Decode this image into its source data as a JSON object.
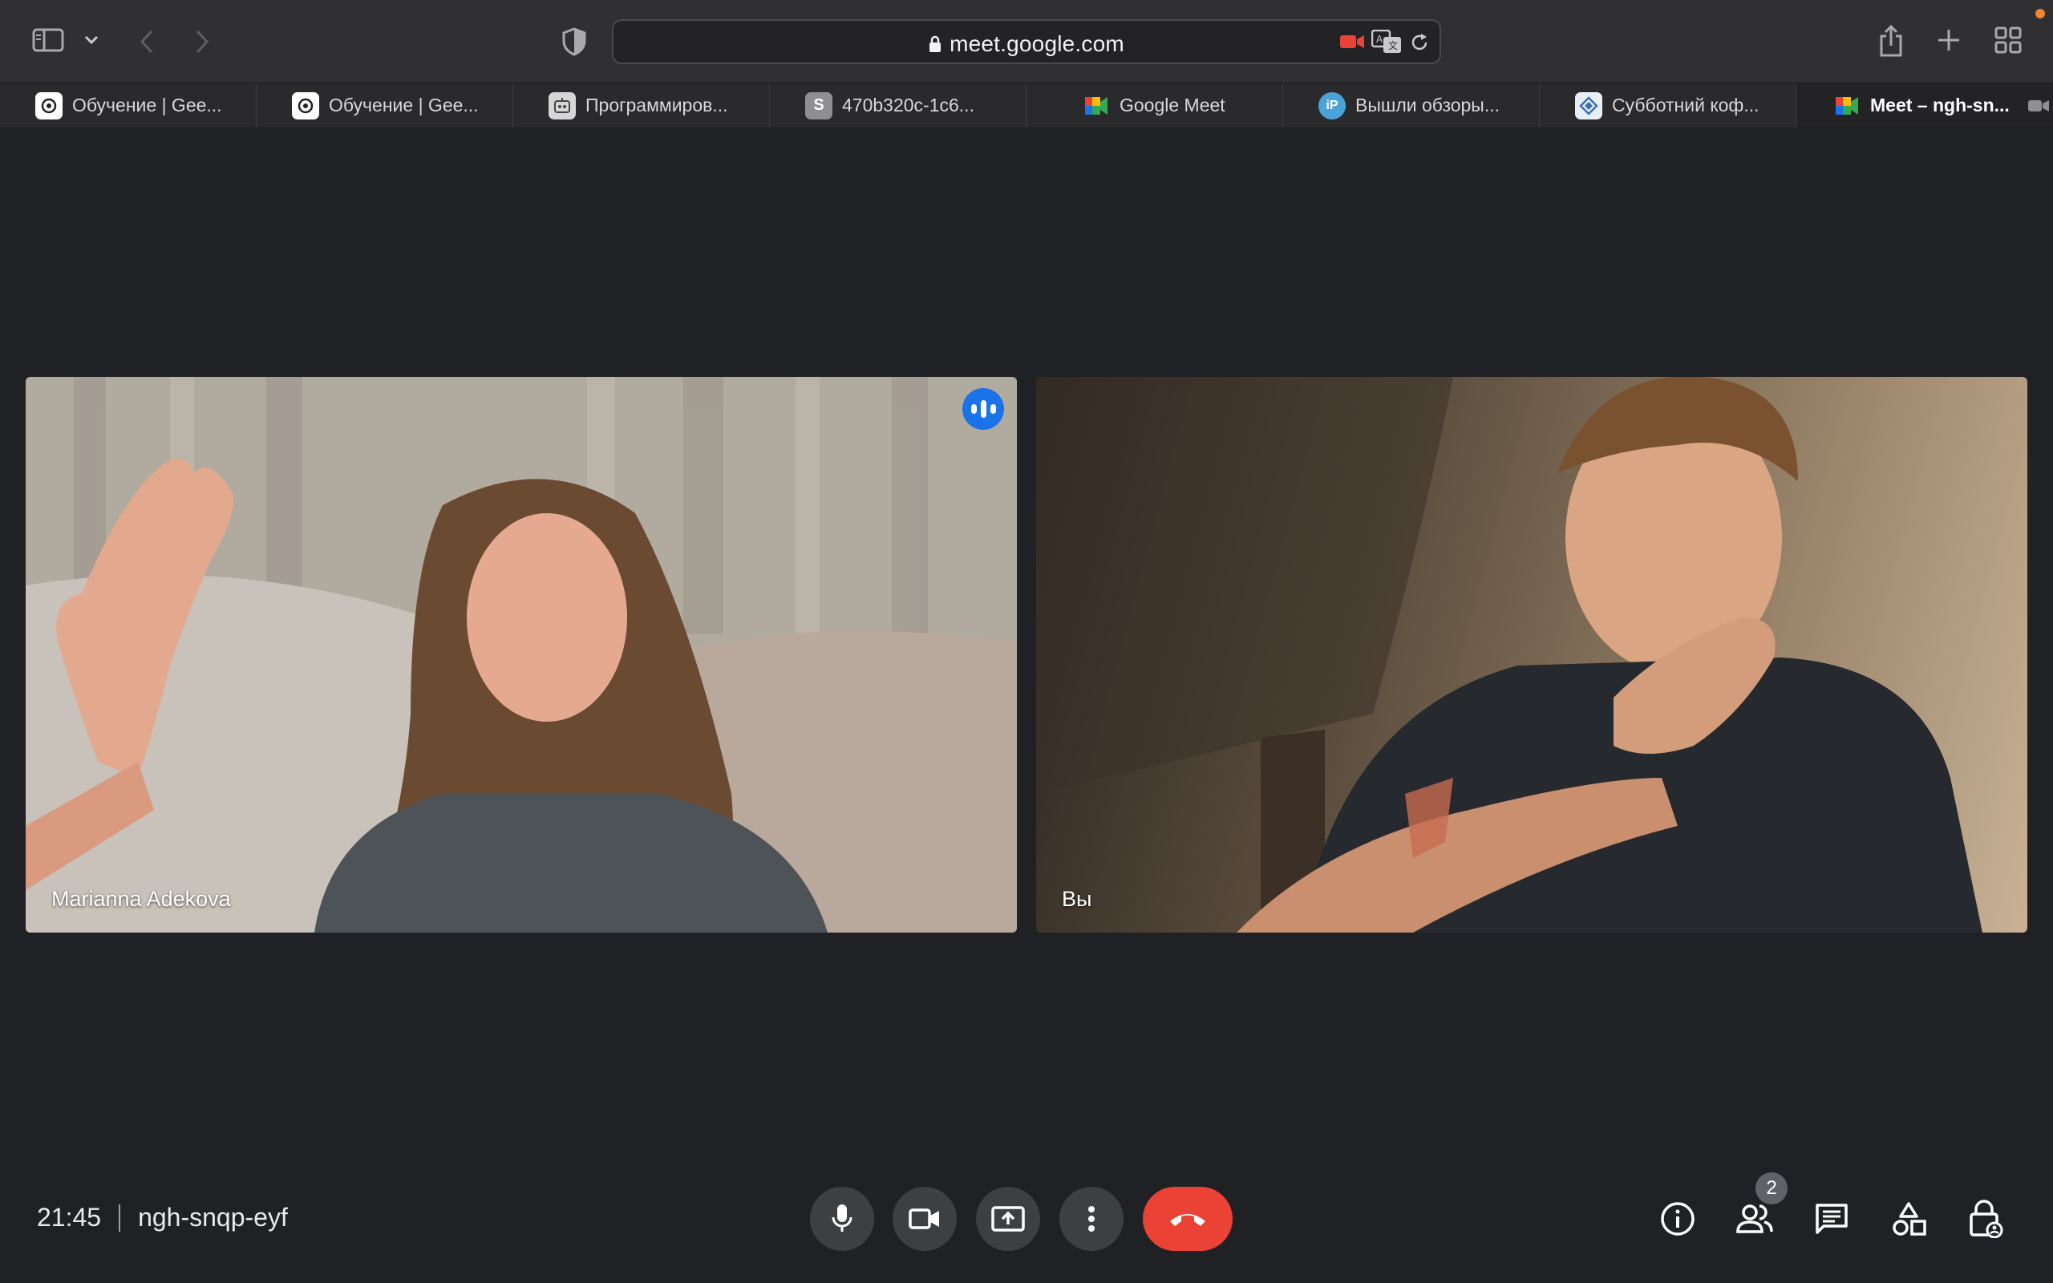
{
  "browser": {
    "url": "meet.google.com",
    "tabs": [
      {
        "title": "Обучение | Gee...",
        "favicon": "openai-icon",
        "active": false
      },
      {
        "title": "Обучение | Gee...",
        "favicon": "openai-icon",
        "active": false
      },
      {
        "title": "Программиров...",
        "favicon": "robot-icon",
        "active": false
      },
      {
        "title": "470b320c-1c6...",
        "favicon": "S",
        "active": false
      },
      {
        "title": "Google Meet",
        "favicon": "google-meet-icon",
        "active": false
      },
      {
        "title": "Вышли обзоры...",
        "favicon": "iP",
        "active": false
      },
      {
        "title": "Субботний коф...",
        "favicon": "diamond-icon",
        "active": false
      },
      {
        "title": "Meet – ngh-sn...",
        "favicon": "google-meet-icon",
        "active": true
      }
    ]
  },
  "meet": {
    "participants": [
      {
        "name": "Marianna Adekova",
        "speaking": true
      },
      {
        "name": "Вы",
        "speaking": false
      }
    ],
    "time": "21:45",
    "meeting_code": "ngh-snqp-eyf",
    "people_count": "2"
  },
  "colors": {
    "accent": "#1a73e8",
    "active_speaker_border": "#6fa2e8",
    "end_call": "#ea4335",
    "background": "#202124"
  }
}
